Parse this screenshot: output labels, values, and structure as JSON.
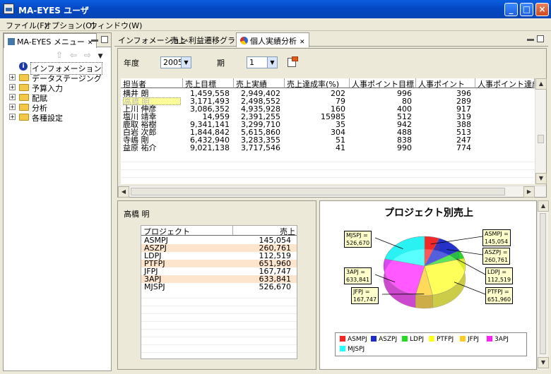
{
  "window": {
    "title": "MA-EYES ユーザ"
  },
  "menubar": [
    "ファイル(F)",
    "オプション(O)",
    "ウィンドウ(W)"
  ],
  "left_panel": {
    "tab_label": "MA-EYES メニュー",
    "tree": [
      {
        "label": "インフォメーション",
        "icon": "info-icon",
        "expandable": false
      },
      {
        "label": "データステージング",
        "icon": "folder-icon",
        "expandable": true
      },
      {
        "label": "予算入力",
        "icon": "folder-icon",
        "expandable": true
      },
      {
        "label": "配賦",
        "icon": "folder-icon",
        "expandable": true
      },
      {
        "label": "分析",
        "icon": "folder-icon",
        "expandable": true
      },
      {
        "label": "各種設定",
        "icon": "folder-icon",
        "expandable": true
      }
    ]
  },
  "editor_tabs": [
    {
      "label": "インフォメーション",
      "active": false
    },
    {
      "label": "売上-利益遷移グラフ",
      "active": false
    },
    {
      "label": "個人実績分析",
      "active": true
    }
  ],
  "filters": {
    "year_label": "年度",
    "year_value": "2005",
    "period_label": "期",
    "period_value": "1"
  },
  "table": {
    "columns": [
      "担当者",
      "売上目標",
      "売上実績",
      "売上達成率(%)",
      "人事ポイント目標",
      "人事ポイント",
      "人事ポイント達成"
    ],
    "rows": [
      [
        "横井 朗",
        "1,459,558",
        "2,949,402",
        "202",
        "996",
        "396"
      ],
      [
        "高橋 明",
        "3,171,493",
        "2,498,552",
        "79",
        "80",
        "289"
      ],
      [
        "上川 伸彦",
        "3,086,352",
        "4,935,928",
        "160",
        "400",
        "917"
      ],
      [
        "塩川 靖幸",
        "14,959",
        "2,391,255",
        "15985",
        "512",
        "319"
      ],
      [
        "鹿取 裕樹",
        "9,341,141",
        "3,299,710",
        "35",
        "942",
        "388"
      ],
      [
        "白岩 次郎",
        "1,844,842",
        "5,615,860",
        "304",
        "488",
        "513"
      ],
      [
        "寺嶋 剛",
        "6,432,940",
        "3,283,355",
        "51",
        "838",
        "247"
      ],
      [
        "益原 祐介",
        "9,021,138",
        "3,717,546",
        "41",
        "990",
        "774"
      ]
    ],
    "selected_row": 1
  },
  "detail": {
    "person": "高橋 明",
    "columns": [
      "プロジェクト",
      "売上"
    ],
    "rows": [
      [
        "ASMPJ",
        "145,054"
      ],
      [
        "ASZPJ",
        "260,761"
      ],
      [
        "LDPJ",
        "112,519"
      ],
      [
        "PTFPJ",
        "651,960"
      ],
      [
        "JFPJ",
        "167,747"
      ],
      [
        "3APJ",
        "633,841"
      ],
      [
        "MJSPJ",
        "526,670"
      ]
    ]
  },
  "chart_data": {
    "type": "pie",
    "title": "プロジェクト別売上",
    "categories": [
      "ASMPJ",
      "ASZPJ",
      "LDPJ",
      "PTFPJ",
      "JFPJ",
      "3APJ",
      "MJSPJ"
    ],
    "values": [
      145054,
      260761,
      112519,
      651960,
      167747,
      633841,
      526670
    ],
    "value_labels": [
      "145,054",
      "260,761",
      "112,519",
      "651,960",
      "167,747",
      "633,841",
      "526,670"
    ],
    "colors": [
      "#ff2020",
      "#1a2ad0",
      "#22dd22",
      "#ffff22",
      "#ffcc22",
      "#ff22ff",
      "#22ffff"
    ],
    "legend_position": "bottom",
    "rendering": "3d-semi-transparent"
  }
}
